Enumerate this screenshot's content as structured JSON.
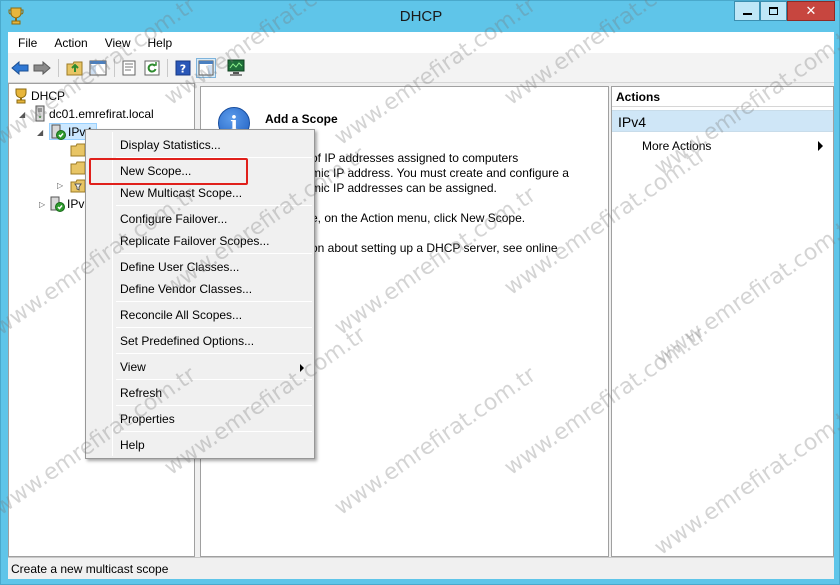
{
  "window": {
    "title": "DHCP",
    "controls": {
      "minimize": "minimize",
      "maximize": "maximize",
      "close": "close"
    }
  },
  "menubar": {
    "items": [
      "File",
      "Action",
      "View",
      "Help"
    ]
  },
  "toolbar": {
    "buttons": [
      "back-icon",
      "forward-icon",
      "up-folder-icon",
      "show-hide-tree-icon",
      "properties-icon",
      "refresh-icon",
      "help-icon",
      "action-pane-icon",
      "server-monitor-icon"
    ]
  },
  "tree": {
    "root": "DHCP",
    "server": "dc01.emrefirat.local",
    "ipv4": "IPv4",
    "ipv6": "IPv"
  },
  "center": {
    "heading": "Add a Scope",
    "lines": [
      "of IP addresses assigned to computers",
      "mic IP address. You must create and configure a",
      "mic IP addresses can be assigned.",
      "e, on the Action menu, click New Scope.",
      "on about setting up a DHCP server, see online"
    ]
  },
  "actions": {
    "header": "Actions",
    "section": "IPv4",
    "more": "More Actions"
  },
  "context_menu": {
    "items": {
      "display_statistics": "Display Statistics...",
      "new_scope": "New Scope...",
      "new_multicast_scope": "New Multicast Scope...",
      "configure_failover": "Configure Failover...",
      "replicate_failover_scopes": "Replicate Failover Scopes...",
      "define_user_classes": "Define User Classes...",
      "define_vendor_classes": "Define Vendor Classes...",
      "reconcile_all_scopes": "Reconcile All Scopes...",
      "set_predefined_options": "Set Predefined Options...",
      "view": "View",
      "refresh": "Refresh",
      "properties": "Properties",
      "help": "Help"
    },
    "highlighted": "New Scope..."
  },
  "statusbar": {
    "text": "Create a new multicast scope"
  },
  "watermark": "www.emrefirat.com.tr",
  "colors": {
    "title_bar": "#5fc5e9",
    "highlight": "#e0201b",
    "actions_section": "#cfe6f7"
  }
}
